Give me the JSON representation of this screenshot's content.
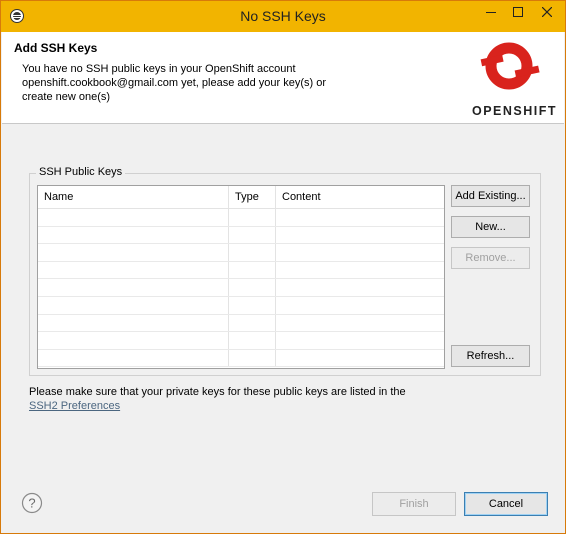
{
  "window": {
    "title": "No SSH Keys"
  },
  "header": {
    "title": "Add SSH Keys",
    "message_line1": "You have no SSH public keys in your OpenShift account",
    "message_line2": "openshift.cookbook@gmail.com yet, please add your key(s) or",
    "message_line3": "create new one(s)",
    "logo_text": "OPENSHIFT"
  },
  "keys_group": {
    "legend": "SSH Public Keys",
    "columns": [
      "Name",
      "Type",
      "Content"
    ],
    "rows": []
  },
  "side_buttons": {
    "add_existing": "Add Existing...",
    "new": "New...",
    "remove": "Remove...",
    "refresh": "Refresh..."
  },
  "note": {
    "text": "Please make sure that your private keys for these public keys are listed in the",
    "link": "SSH2 Preferences"
  },
  "footer": {
    "finish": "Finish",
    "cancel": "Cancel"
  },
  "icons": {
    "app": "eclipse-icon",
    "minimize": "minimize-icon",
    "maximize": "maximize-icon",
    "close": "close-icon",
    "help": "help-icon",
    "logo": "openshift-logo"
  },
  "colors": {
    "titlebar": "#f2b400",
    "logo_red": "#d9231d",
    "link": "#4b6680"
  }
}
